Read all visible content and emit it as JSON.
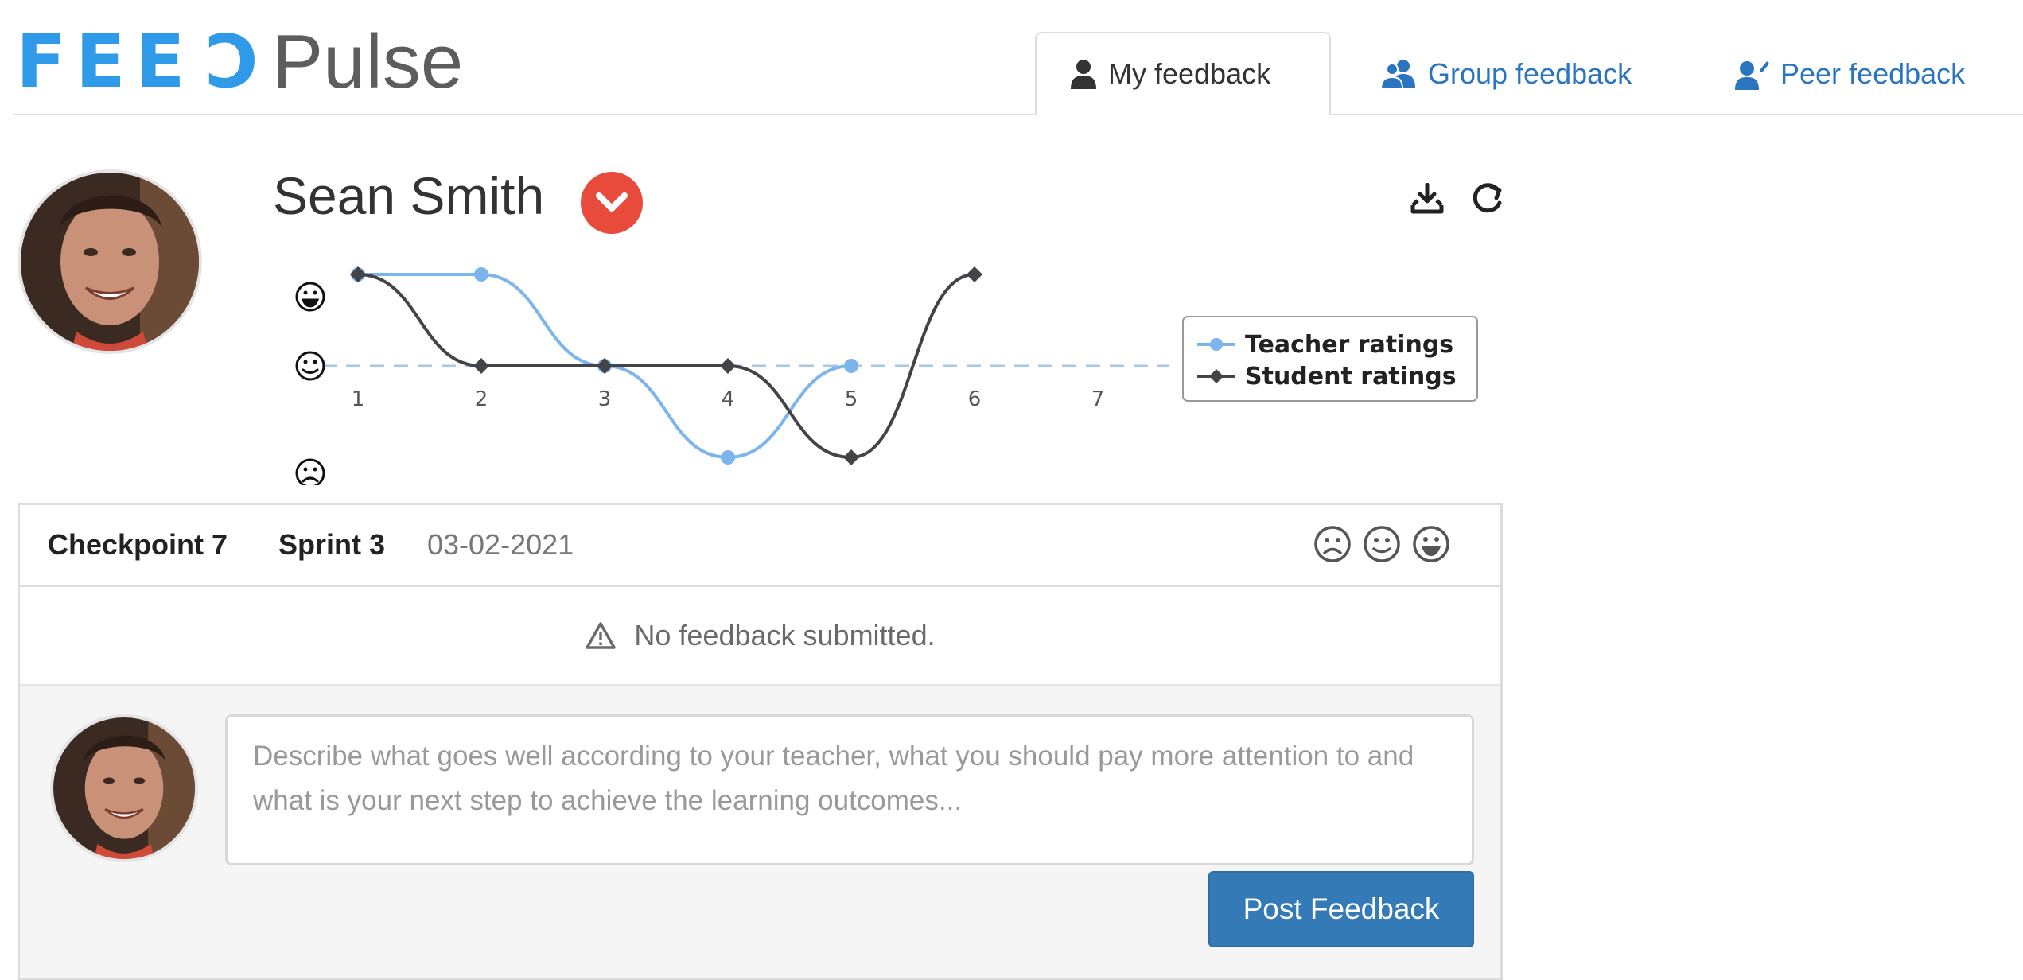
{
  "header": {
    "logo": {
      "feed": "FEED",
      "pulse": "Pulse"
    },
    "tabs": [
      {
        "label": "My feedback",
        "icon": "user-icon",
        "active": true
      },
      {
        "label": "Group feedback",
        "icon": "group-icon",
        "active": false
      },
      {
        "label": "Peer feedback",
        "icon": "peer-icon",
        "active": false
      }
    ]
  },
  "profile": {
    "name": "Sean Smith",
    "dropdown_icon": "chevron-down-icon",
    "toolbar_icons": [
      "download-icon",
      "refresh-icon"
    ]
  },
  "chart_data": {
    "type": "line",
    "x": [
      1,
      2,
      3,
      4,
      5,
      6,
      7
    ],
    "y_levels": [
      "☺",
      "☺",
      "☹"
    ],
    "ylim": [
      -1,
      1
    ],
    "series": [
      {
        "name": "Teacher ratings",
        "x": [
          1,
          2,
          3,
          4,
          5
        ],
        "values": [
          1,
          1,
          0,
          -1,
          0
        ],
        "color": "#7cb5ec",
        "marker": "circle"
      },
      {
        "name": "Student ratings",
        "x": [
          1,
          2,
          3,
          4,
          5,
          6
        ],
        "values": [
          1,
          0,
          0,
          0,
          -1,
          1
        ],
        "color": "#434348",
        "marker": "diamond"
      }
    ],
    "neutral_line": 0,
    "legend_placement": "right"
  },
  "checkpoint": {
    "title": "Checkpoint 7",
    "sprint": "Sprint 3",
    "date": "03-02-2021",
    "rating_icons": [
      "sad-face-icon",
      "neutral-face-icon",
      "happy-face-icon"
    ],
    "notice": "No feedback submitted.",
    "feedback_placeholder": "Describe what goes well according to your teacher, what you should pay more attention to and what is your next step to achieve the learning outcomes...",
    "post_label": "Post Feedback"
  },
  "colors": {
    "brand_blue": "#2f9be8",
    "link_blue": "#2a74c0",
    "danger_red": "#e84a3c",
    "button_blue": "#337ab7"
  }
}
